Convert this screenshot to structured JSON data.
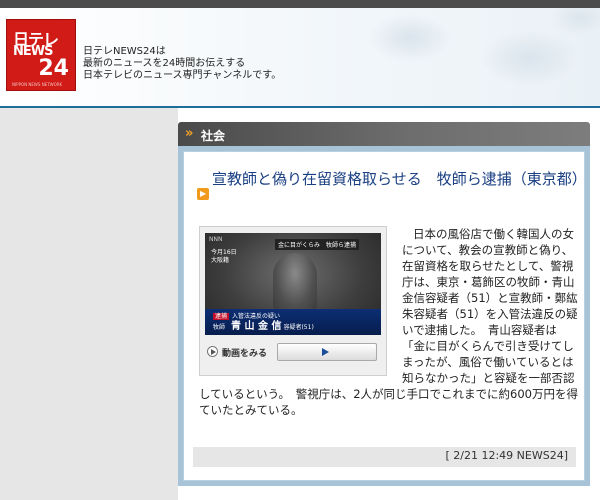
{
  "header": {
    "logo": {
      "line1": "日テレ",
      "line2": "NEWS",
      "line3": "24",
      "network": "NIPPON NEWS NETWORK"
    },
    "tagline": [
      "日テレNEWS24は",
      "最新のニュースを24時間お伝えする",
      "日本テレビのニュース専門チャンネルです。"
    ]
  },
  "section": {
    "chevron": "»",
    "label": "社会"
  },
  "article": {
    "headline": "宣教師と偽り在留資格取らせる　牧師ら逮捕（東京都）",
    "body_lines": [
      "日本の風俗店で働く韓国人の女",
      "について、教会の宣教師と偽り、",
      "在留資格を取らせたとして、警視",
      "庁は、東京・葛飾区の牧師・青山",
      "金信容疑者（51）と宣教師・鄭紘",
      "朱容疑者（51）を入管法違反の疑",
      "いで逮捕した。　青山容疑者は",
      "「金に目がくらんで引き受けてし",
      "まったが、風俗で働いているとは",
      "知らなかった」と容疑を一部否認",
      "しているという。　警視庁は、2人が同じ手口でこれまでに約600万円を得",
      "ていたとみている。"
    ],
    "footer": "[ 2/21 12:49 NEWS24]"
  },
  "video": {
    "network": "NNN",
    "top_caption": "金に目がくらみ　牧師ら逮捕",
    "date": "今月16日",
    "location": "大阪籍",
    "caption_tag": "逮捕",
    "caption_line": "入管法違反の疑い",
    "role": "牧師",
    "name": "青 山 金 信",
    "suffix": "容疑者(51)",
    "label": "動画をみる"
  },
  "colors": {
    "logo_red": "#d01b17",
    "headline_blue": "#1a3f82",
    "frame_blue": "#a7c3d8",
    "accent_orange": "#f19a1c"
  }
}
